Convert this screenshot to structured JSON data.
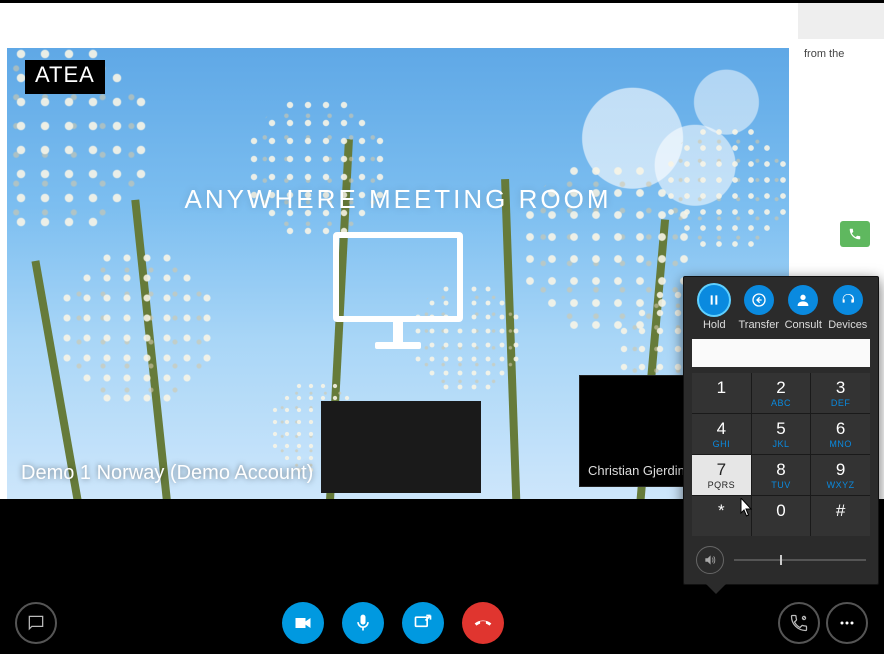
{
  "brand": "ATEA",
  "video": {
    "meeting_text": "ANYWHERE MEETING ROOM",
    "caller_name": "Demo 1 Norway (Demo Account)",
    "pip_name": "Christian Gjerding"
  },
  "chat": {
    "fragment": "from the"
  },
  "toolbar": {
    "chat": "Chat",
    "video": "Video",
    "mic": "Mute",
    "share": "Present",
    "hangup": "Hang up",
    "dialpad": "Dial pad",
    "more": "More"
  },
  "dialpad": {
    "actions": {
      "hold": "Hold",
      "transfer": "Transfer",
      "consult": "Consult",
      "devices": "Devices"
    },
    "input_value": "",
    "keys": [
      {
        "d": "1",
        "l": ""
      },
      {
        "d": "2",
        "l": "ABC"
      },
      {
        "d": "3",
        "l": "DEF"
      },
      {
        "d": "4",
        "l": "GHI"
      },
      {
        "d": "5",
        "l": "JKL"
      },
      {
        "d": "6",
        "l": "MNO"
      },
      {
        "d": "7",
        "l": "PQRS"
      },
      {
        "d": "8",
        "l": "TUV"
      },
      {
        "d": "9",
        "l": "WXYZ"
      },
      {
        "d": "*",
        "l": ""
      },
      {
        "d": "0",
        "l": ""
      },
      {
        "d": "#",
        "l": ""
      }
    ],
    "hover_key_index": 6,
    "volume_percent": 35
  },
  "colors": {
    "accent": "#0a8adf",
    "danger": "#e0352f",
    "call_green": "#5fb85f"
  }
}
